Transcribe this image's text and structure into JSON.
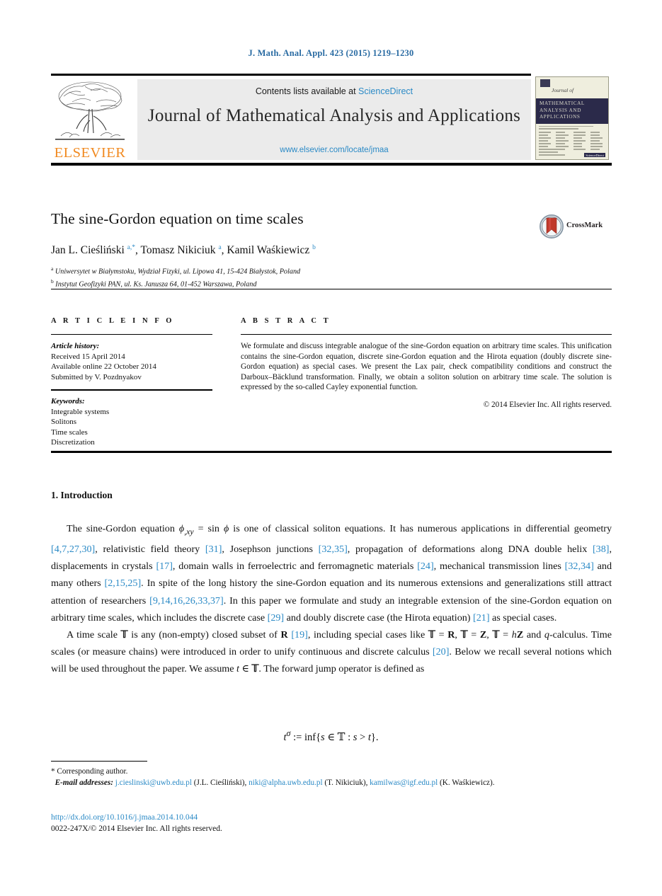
{
  "running_head": "J. Math. Anal. Appl. 423 (2015) 1219–1230",
  "masthead": {
    "contents_prefix": "Contents lists available at ",
    "sciencedirect": "ScienceDirect",
    "journal_title": "Journal of Mathematical Analysis and Applications",
    "journal_url": "www.elsevier.com/locate/jmaa",
    "publisher": "ELSEVIER",
    "cover": {
      "journal_of": "Journal of",
      "band_line1": "MATHEMATICAL",
      "band_line2": "ANALYSIS AND",
      "band_line3": "APPLICATIONS",
      "sciencedirect_badge": "ScienceDirect"
    }
  },
  "article": {
    "title": "The sine-Gordon equation on time scales",
    "crossmark_label": "CrossMark",
    "authors_html": "Jan L. Cieśliński <sup>a,*</sup>, Tomasz Nikiciuk <sup>a</sup>, Kamil Waśkiewicz <sup>b</sup>",
    "affiliation_a": "Uniwersytet w Białymstoku, Wydział Fizyki, ul. Lipowa 41, 15-424 Białystok, Poland",
    "affiliation_b": "Instytut Geofizyki PAN, ul. Ks. Janusza 64, 01-452 Warszawa, Poland"
  },
  "article_info": {
    "heading": "A R T I C L E    I N F O",
    "history_label": "Article history:",
    "history": [
      "Received 15 April 2014",
      "Available online 22 October 2014",
      "Submitted by V. Pozdnyakov"
    ],
    "keywords_label": "Keywords:",
    "keywords": [
      "Integrable systems",
      "Solitons",
      "Time scales",
      "Discretization"
    ]
  },
  "abstract": {
    "heading": "A B S T R A C T",
    "text": "We formulate and discuss integrable analogue of the sine-Gordon equation on arbitrary time scales. This unification contains the sine-Gordon equation, discrete sine-Gordon equation and the Hirota equation (doubly discrete sine-Gordon equation) as special cases. We present the Lax pair, check compatibility conditions and construct the Darboux–Bäcklund transformation. Finally, we obtain a soliton solution on arbitrary time scale. The solution is expressed by the so-called Cayley exponential function.",
    "copyright": "© 2014 Elsevier Inc. All rights reserved."
  },
  "body": {
    "section_heading": "1. Introduction",
    "paragraph1_html": "The sine-Gordon equation <i>ϕ<sub>,xy</sub></i> = sin <i>ϕ</i> is one of classical soliton equations. It has numerous applications in differential geometry <span class=\"ref\">[4,7,27,30]</span>, relativistic field theory <span class=\"ref\">[31]</span>, Josephson junctions <span class=\"ref\">[32,35]</span>, propagation of deformations along DNA double helix <span class=\"ref\">[38]</span>, displacements in crystals <span class=\"ref\">[17]</span>, domain walls in ferroelectric and ferromagnetic materials <span class=\"ref\">[24]</span>, mechanical transmission lines <span class=\"ref\">[32,34]</span> and many others <span class=\"ref\">[2,15,25]</span>. In spite of the long history the sine-Gordon equation and its numerous extensions and generalizations still attract attention of researchers <span class=\"ref\">[9,14,16,26,33,37]</span>. In this paper we formulate and study an integrable extension of the sine-Gordon equation on arbitrary time scales, which includes the discrete case <span class=\"ref\">[29]</span> and doubly discrete case (the Hirota equation) <span class=\"ref\">[21]</span> as special cases.",
    "paragraph2_html": "A time scale <b>&#120139;</b> is any (non-empty) closed subset of <b>R</b> <span class=\"ref\">[19]</span>, including special cases like <b>&#120139;</b> = <b>R</b>, <b>&#120139;</b> = <b>Z</b>, <b>&#120139;</b> = <i>h</i><b>Z</b> and <i>q</i>-calculus. Time scales (or measure chains) were introduced in order to unify continuous and discrete calculus <span class=\"ref\">[20]</span>. Below we recall several notions which will be used throughout the paper. We assume <i>t</i> ∈ <b>&#120139;</b>. The forward jump operator is defined as",
    "equation_html": "<i>t</i><sup><i>σ</i></sup> := inf{<i>s</i> ∈ &#120139; : <i>s</i> &gt; <i>t</i>}."
  },
  "footnotes": {
    "corresponding": "*  Corresponding author.",
    "email_label": "E-mail addresses:",
    "emails_html": "<a href=\"#\">j.cieslinski@uwb.edu.pl</a> (J.L. Cieśliński), <a href=\"#\">niki@alpha.uwb.edu.pl</a> (T. Nikiciuk), <a href=\"#\">kamilwas@igf.edu.pl</a> (K. Waśkiewicz).",
    "doi": "http://dx.doi.org/10.1016/j.jmaa.2014.10.044",
    "issn": "0022-247X/© 2014 Elsevier Inc. All rights reserved."
  },
  "colors": {
    "link_blue": "#2b8ac6",
    "running_head_blue": "#2b6ca3",
    "elsevier_orange": "#f18a21",
    "cover_navy": "#2b2a4a",
    "band_gray": "#ebebeb"
  }
}
